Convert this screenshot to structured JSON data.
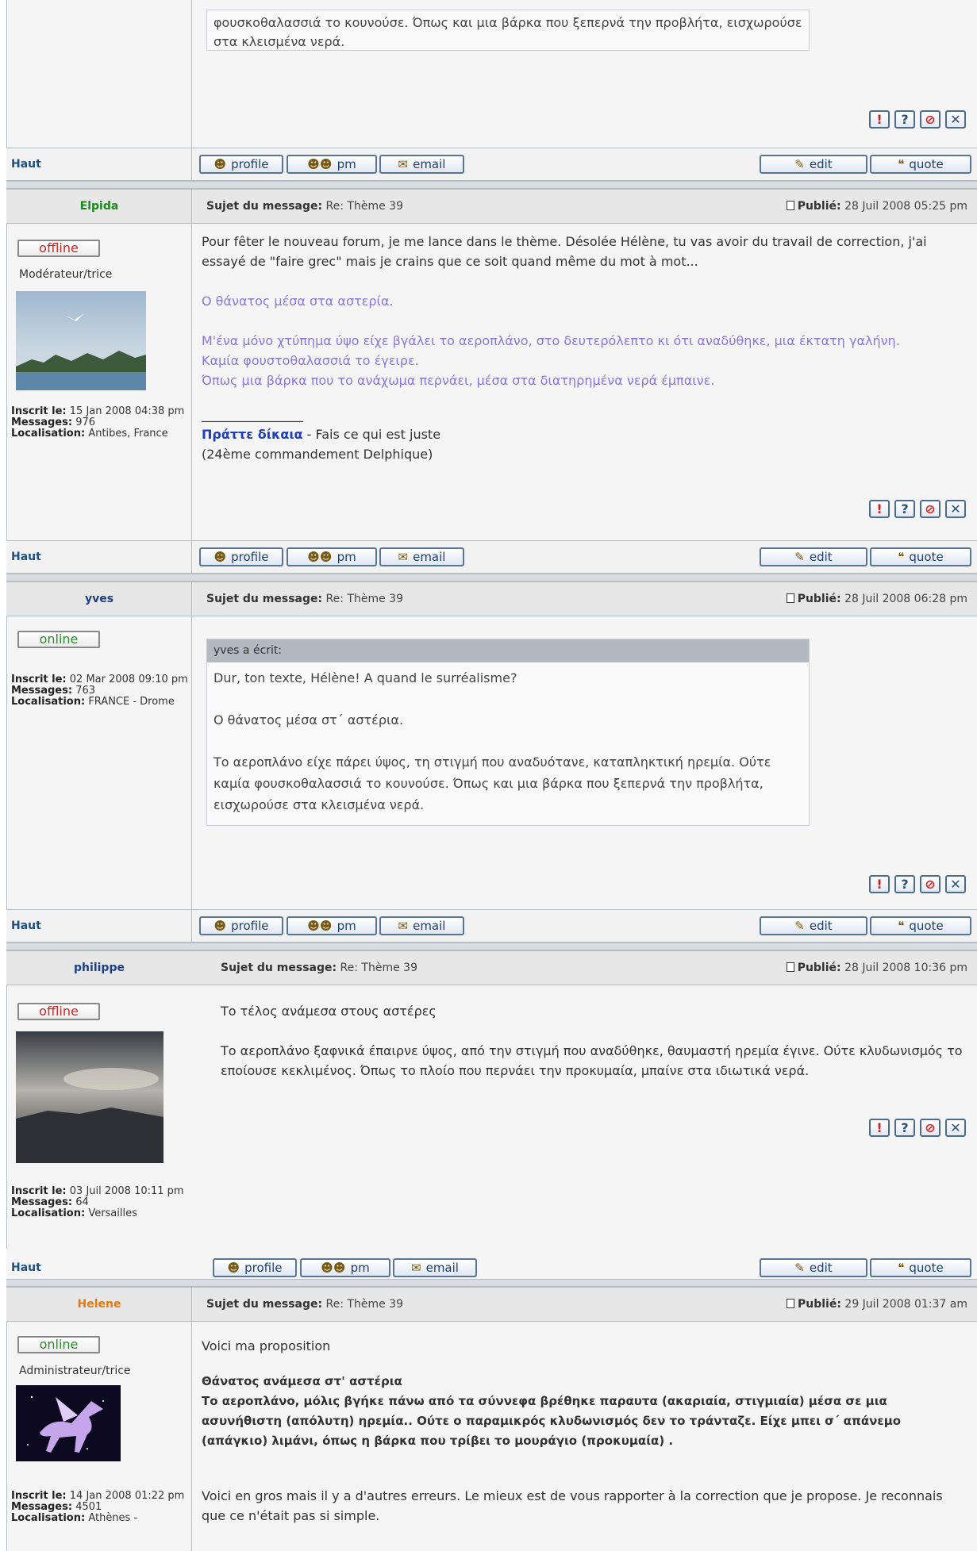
{
  "footer_labels": {
    "haut": "Haut",
    "profile": "profile",
    "pm": "pm",
    "email": "email",
    "edit": "edit",
    "quote": "quote"
  },
  "labels": {
    "subject": "Sujet du message:",
    "published": "Publié:",
    "registered": "Inscrit le:",
    "messages": "Messages:",
    "location": "Localisation:"
  },
  "top": {
    "text": "φουσκοθαλασσιά το κουνούσε. Όπως και μια βάρκα που ξεπερνά την προβλήτα, εισχωρούσε στα κλεισμένα νερά."
  },
  "posts": [
    {
      "author": "Elpida",
      "author_color": "#1a8a1a",
      "status": "offline",
      "rank": "Modérateur/trice",
      "subject": "Re: Thème 39",
      "date": "28 Juil 2008 05:25 pm",
      "registered": "15 Jan 2008 04:38 pm",
      "messages": "976",
      "location": "Antibes, France",
      "p1": "Pour fêter le nouveau forum, je me lance dans le thème. Désolée Hélène, tu vas avoir du travail de correction, j'ai essayé de \"faire grec\" mais je crains que ce soit quand même du mot à mot...",
      "p2": "Ο θάνατος μέσα στα αστερία.",
      "p3": "Μ'ένα μόνο χτύπημα ύψο είχε βγάλει το αεροπλάνο, στο δευτερόλεπτο κι ότι αναδύθηκε, μια έκτατη γαλήνη.",
      "p4": "Καμία φουστοθαλασσιά το έγειρε.",
      "p5": "Όπως μια βάρκα που το ανάχωμα περνάει, μέσα στα διατηρημένα νερά έμπαινε.",
      "sig_line": "________________",
      "sig_bold": "Πράττε δίκαια",
      "sig_rest": " - Fais ce qui est juste",
      "sig_2": "(24ème commandement Delphique)"
    },
    {
      "author": "yves",
      "author_color": "#1d3f80",
      "status": "online",
      "subject": "Re: Thème 39",
      "date": "28 Juil 2008 06:28 pm",
      "registered": "02 Mar 2008 09:10 pm",
      "messages": "763",
      "location": "FRANCE - Drome",
      "quote_head": "yves a écrit:",
      "q1": "Dur, ton texte, Hélène! A quand le surréalisme?",
      "q2": "Ο θάνατος μέσα στ΄ αστέρια.",
      "q3": "Το αεροπλάνο είχε πάρει ύψος, τη στιγμή που αναδυότανε, καταπληκτική ηρεμία. Ούτε καμία φουσκοθαλασσιά το κουνούσε. Όπως και μια βάρκα που ξεπερνά την προβλήτα, εισχωρούσε στα κλεισμένα νερά."
    },
    {
      "author": "philippe",
      "author_color": "#1d3f80",
      "status": "offline",
      "subject": "Re: Thème 39",
      "date": "28 Juil 2008 10:36 pm",
      "registered": "03 Juil 2008 10:11 pm",
      "messages": "64",
      "location": "Versailles",
      "p1": "Το τέλος ανάμεσα στους αστέρες",
      "p2": "Το αεροπλάνο ξαφνικά έπαιρνε ύψος, από την στιγμή που αναδύθηκε, θαυμαστή ηρεμία έγινε. Ούτε κλυδωνισμός το εποίουσε κεκλιμένος. Όπως το πλοίο που περνάει την προκυμαία, μπαίνε στα ιδιωτικά νερά."
    },
    {
      "author": "Helene",
      "author_color": "#e07a10",
      "status": "online",
      "rank": "Administrateur/trice",
      "subject": "Re: Thème 39",
      "date": "29 Juil 2008 01:37 am",
      "registered": "14 Jan 2008 01:22 pm",
      "messages": "4501",
      "location": "Athènes -",
      "p1": "Voici ma proposition",
      "b1": "Θάνατος ανάμεσα στ' αστέρια",
      "b2": "Το αεροπλάνο, μόλις βγήκε πάνω από τα σύννεφα βρέθηκε παραυτα (ακαριαία, στιγμιαία) μέσα σε μια ασυνήθιστη (απόλυτη) ηρεμία.. Ούτε ο παραμικρός κλυδωνισμός δεν το τράνταζε. Είχε μπει σ΄ απάνεμο (απάγκιο) λιμάνι, όπως η βάρκα που τρίβει το μουράγιο (προκυμαία) .",
      "p2": "Voici en gros mais il y a d'autres erreurs. Le mieux est de vous rapporter à la correction que je propose. Je reconnais que ce n'était pas si simple."
    }
  ]
}
